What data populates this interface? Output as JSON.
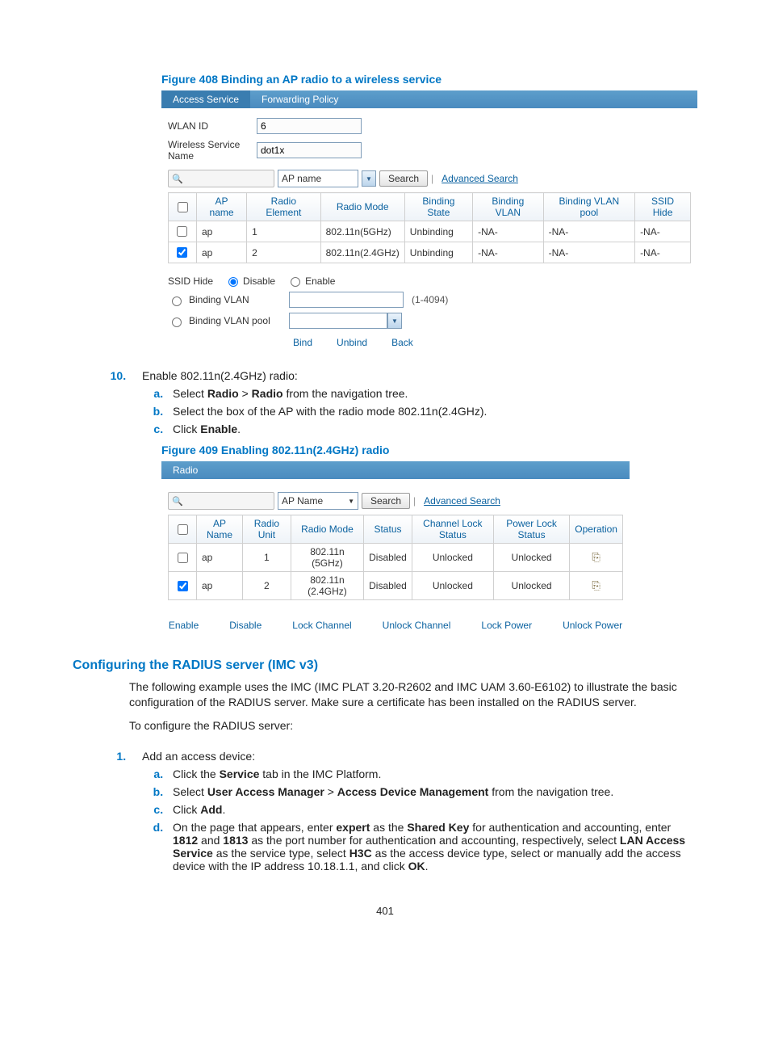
{
  "figure408": {
    "caption": "Figure 408 Binding an AP radio to a wireless service",
    "tabs": [
      "Access Service",
      "Forwarding Policy"
    ],
    "wlan_id_label": "WLAN ID",
    "wlan_id_value": "6",
    "wsn_label": "Wireless Service Name",
    "wsn_value": "dot1x",
    "search_field_label": "AP name",
    "search_btn": "Search",
    "adv_search": "Advanced Search",
    "table": {
      "headers": [
        "AP name",
        "Radio Element",
        "Radio Mode",
        "Binding State",
        "Binding VLAN",
        "Binding VLAN pool",
        "SSID Hide"
      ],
      "rows": [
        {
          "checked": false,
          "cells": [
            "ap",
            "1",
            "802.11n(5GHz)",
            "Unbinding",
            "-NA-",
            "-NA-",
            "-NA-"
          ]
        },
        {
          "checked": true,
          "cells": [
            "ap",
            "2",
            "802.11n(2.4GHz)",
            "Unbinding",
            "-NA-",
            "-NA-",
            "-NA-"
          ]
        }
      ]
    },
    "ssid_hide_label": "SSID Hide",
    "ssid_hide_disable": "Disable",
    "ssid_hide_enable": "Enable",
    "binding_vlan_label": "Binding VLAN",
    "binding_vlan_hint": "(1-4094)",
    "binding_vlanpool_label": "Binding VLAN pool",
    "actions": {
      "bind": "Bind",
      "unbind": "Unbind",
      "back": "Back"
    }
  },
  "step10": {
    "intro": "Enable 802.11n(2.4GHz) radio:",
    "a_pre": "Select ",
    "a_b1": "Radio",
    "a_sep": " > ",
    "a_b2": "Radio",
    "a_post": " from the navigation tree.",
    "b": "Select the box of the AP with the radio mode 802.11n(2.4GHz).",
    "c_pre": "Click ",
    "c_b": "Enable",
    "c_post": "."
  },
  "figure409": {
    "caption": "Figure 409 Enabling 802.11n(2.4GHz) radio",
    "tab": "Radio",
    "search_field_label": "AP Name",
    "search_btn": "Search",
    "adv_search": "Advanced Search",
    "table": {
      "headers": [
        "AP Name",
        "Radio Unit",
        "Radio Mode",
        "Status",
        "Channel Lock Status",
        "Power Lock Status",
        "Operation"
      ],
      "rows": [
        {
          "checked": false,
          "cells": [
            "ap",
            "1",
            "802.11n (5GHz)",
            "Disabled",
            "Unlocked",
            "Unlocked"
          ]
        },
        {
          "checked": true,
          "cells": [
            "ap",
            "2",
            "802.11n (2.4GHz)",
            "Disabled",
            "Unlocked",
            "Unlocked"
          ]
        }
      ]
    },
    "actions": [
      "Enable",
      "Disable",
      "Lock Channel",
      "Unlock Channel",
      "Lock Power",
      "Unlock Power"
    ]
  },
  "sect_heading": "Configuring the RADIUS server (IMC v3)",
  "para1": "The following example uses the IMC (IMC PLAT 3.20-R2602 and IMC UAM 3.60-E6102) to illustrate the basic configuration of the RADIUS server. Make sure a certificate has been installed on the RADIUS server.",
  "para2": "To configure the RADIUS server:",
  "step1": {
    "intro": "Add an access device:",
    "a_pre": "Click the ",
    "a_b": "Service",
    "a_post": " tab in the IMC Platform.",
    "b_pre": "Select ",
    "b_b1": "User Access Manager",
    "b_sep": " > ",
    "b_b2": "Access Device Management",
    "b_post": " from the navigation tree.",
    "c_pre": "Click ",
    "c_b": "Add",
    "c_post": ".",
    "d_1": "On the page that appears, enter ",
    "d_b1": "expert",
    "d_2": " as the ",
    "d_b2": "Shared Key",
    "d_3": " for authentication and accounting, enter ",
    "d_b3": "1812",
    "d_4": " and ",
    "d_b4": "1813",
    "d_5": " as the port number for authentication and accounting, respectively, select ",
    "d_b5": "LAN Access Service",
    "d_6": " as the service type, select ",
    "d_b6": "H3C",
    "d_7": " as the access device type, select or manually add the access device with the IP address 10.18.1.1, and click ",
    "d_b7": "OK",
    "d_8": "."
  },
  "pagenum": "401"
}
